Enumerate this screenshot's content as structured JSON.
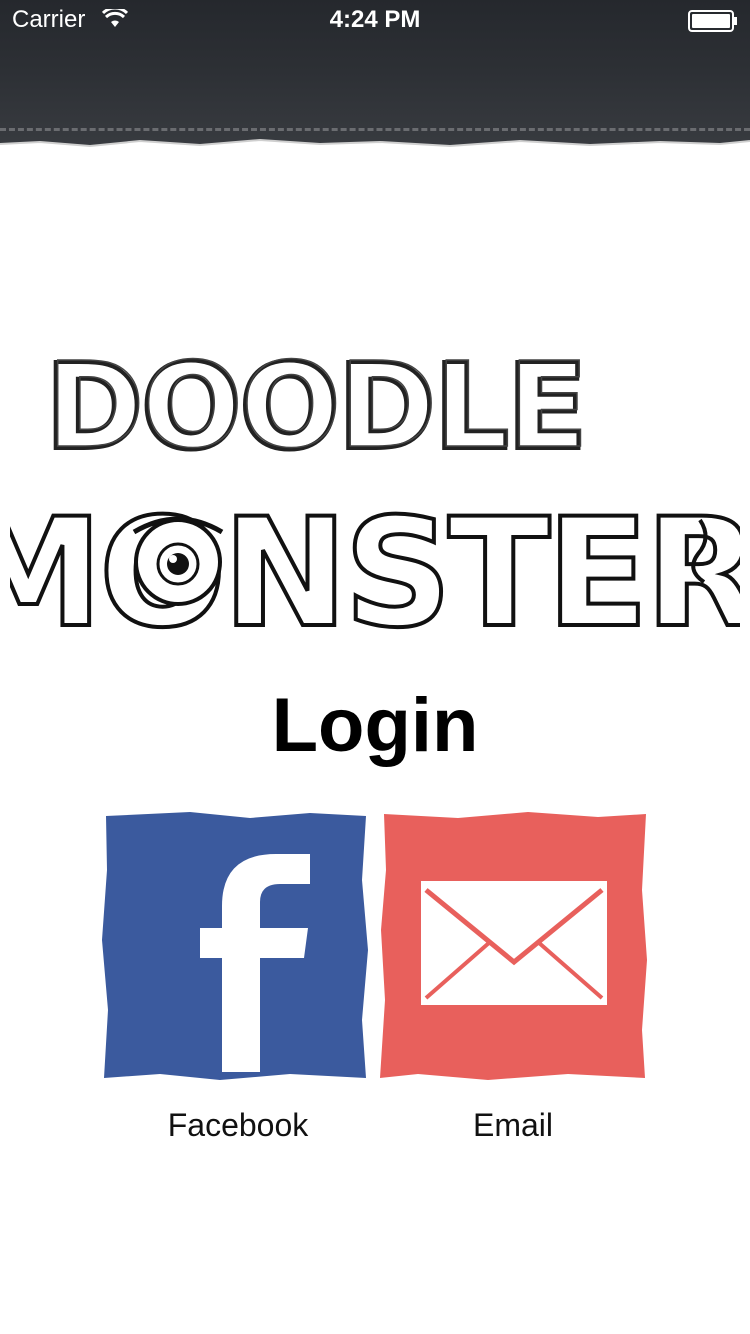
{
  "status_bar": {
    "carrier": "Carrier",
    "time": "4:24 PM"
  },
  "logo": {
    "line1": "DOODLE",
    "line2": "MONSTER"
  },
  "title": "Login",
  "login_options": [
    {
      "label": "Facebook",
      "icon": "facebook-icon",
      "color": "#3b5a9e"
    },
    {
      "label": "Email",
      "icon": "envelope-icon",
      "color": "#e8605c"
    }
  ]
}
